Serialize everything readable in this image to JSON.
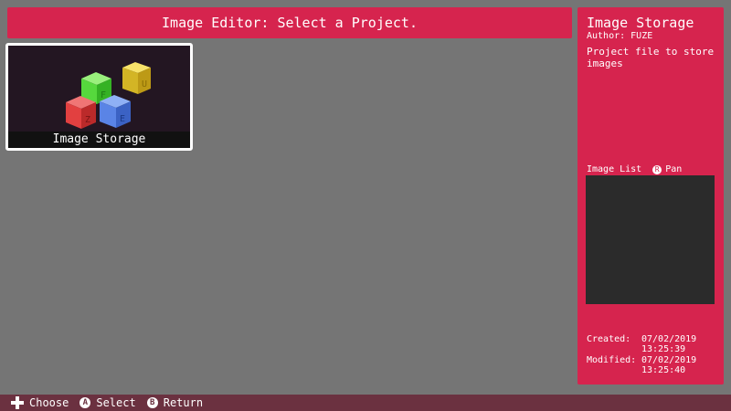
{
  "header": {
    "title": "Image Editor: Select a Project."
  },
  "project_tile": {
    "label": "Image Storage",
    "cube_letters": [
      "F",
      "U",
      "Z",
      "E"
    ]
  },
  "side_panel": {
    "title": "Image Storage",
    "author": "Author: FUZE",
    "description": "Project file to store images",
    "list_label": "Image List",
    "pan_button_glyph": "R",
    "pan_label": "Pan",
    "created_label": "Created:",
    "created_date": "07/02/2019",
    "created_time": "13:25:39",
    "modified_label": "Modified:",
    "modified_date": "07/02/2019",
    "modified_time": "13:25:40"
  },
  "footer": {
    "choose": "Choose",
    "a_glyph": "A",
    "select": "Select",
    "b_glyph": "B",
    "return": "Return"
  },
  "colors": {
    "accent": "#d6244e",
    "background": "#757575",
    "footer": "#6b3140"
  }
}
